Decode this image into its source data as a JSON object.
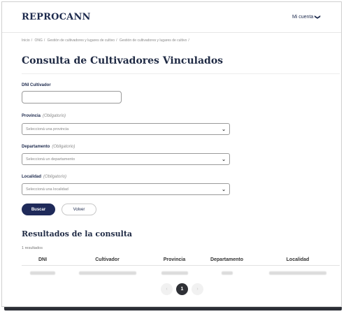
{
  "header": {
    "brand": "REPROCANN",
    "account_label": "Mi cuenta",
    "account_chevron": "❯"
  },
  "breadcrumb": {
    "items": [
      "Inicio",
      "ONG",
      "Gestión de cultivadores y lugares de cultivo",
      "Gestión de cultivadores y lugares de cultivo"
    ]
  },
  "page": {
    "title": "Consulta de Cultivadores Vinculados"
  },
  "form": {
    "dni_label": "DNI Cultivador",
    "dni_value": "",
    "provincia_label": "Provincia",
    "provincia_req": "(Obligatorio)",
    "provincia_placeholder": "Seleccioná una provincia",
    "departamento_label": "Departamento",
    "departamento_req": "(Obligatorio)",
    "departamento_placeholder": "Seleccioná un departamento",
    "localidad_label": "Localidad",
    "localidad_req": "(Obligatorio)",
    "localidad_placeholder": "Seleccioná una localidad",
    "search_button": "Buscar",
    "back_button": "Volver"
  },
  "results": {
    "title": "Resultados de la consulta",
    "count_text": "1 resultados",
    "columns": [
      "DNI",
      "Cultivador",
      "Provincia",
      "Departamento",
      "Localidad"
    ]
  },
  "pagination": {
    "prev": "‹",
    "current": "1",
    "next": "›"
  },
  "icons": {
    "select_arrow": "chevron-down-icon",
    "account_arrow": "chevron-down-icon"
  },
  "colors": {
    "primary": "#1f2a5a",
    "title": "#1f2a44"
  }
}
